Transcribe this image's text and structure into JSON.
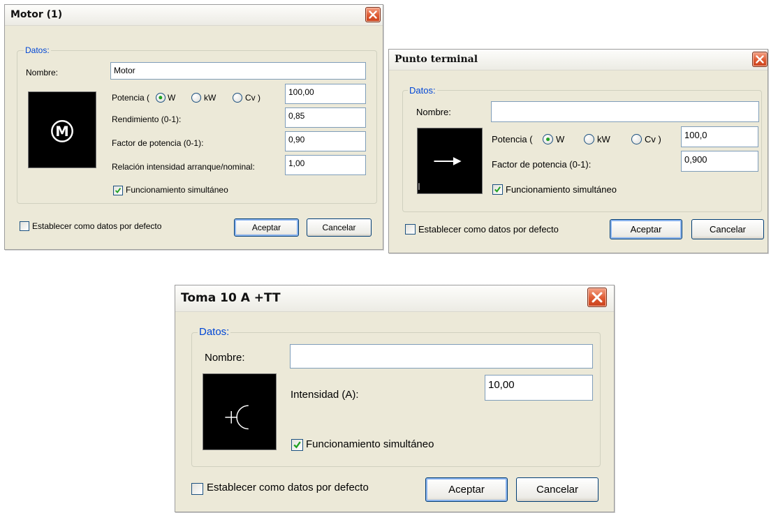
{
  "motor_dialog": {
    "title": "Motor (1)",
    "group_label": "Datos:",
    "name_label": "Nombre:",
    "name_value": "Motor",
    "icon_letter": "M",
    "power_label_prefix": "Potencia (",
    "power_units": [
      "W",
      "kW",
      "Cv )"
    ],
    "power_selected": "W",
    "power_value": "100,00",
    "efficiency_label": "Rendimiento (0-1):",
    "efficiency_value": "0,85",
    "power_factor_label": "Factor de potencia (0-1):",
    "power_factor_value": "0,90",
    "start_ratio_label": "Relación intensidad arranque/nominal:",
    "start_ratio_value": "1,00",
    "simultaneous_label": "Funcionamiento simultáneo",
    "simultaneous_checked": true,
    "default_label": "Establecer como datos por defecto",
    "default_checked": false,
    "accept_label": "Aceptar",
    "cancel_label": "Cancelar"
  },
  "terminal_dialog": {
    "title": "Punto terminal",
    "group_label": "Datos:",
    "name_label": "Nombre:",
    "name_value": "",
    "power_label_prefix": "Potencia (",
    "power_units": [
      "W",
      "kW",
      "Cv )"
    ],
    "power_selected": "W",
    "power_value": "100,0",
    "power_factor_label": "Factor de potencia (0-1):",
    "power_factor_value": "0,900",
    "simultaneous_label": "Funcionamiento simultáneo",
    "simultaneous_checked": true,
    "default_label": "Establecer como datos por defecto",
    "default_checked": false,
    "accept_label": "Aceptar",
    "cancel_label": "Cancelar"
  },
  "toma_dialog": {
    "title": "Toma 10 A +TT",
    "group_label": "Datos:",
    "name_label": "Nombre:",
    "name_value": "",
    "current_label": "Intensidad (A):",
    "current_value": "10,00",
    "simultaneous_label": "Funcionamiento simultáneo",
    "simultaneous_checked": true,
    "default_label": "Establecer como datos por defecto",
    "default_checked": false,
    "accept_label": "Aceptar",
    "cancel_label": "Cancelar"
  },
  "colors": {
    "dialog_bg": "#ece9d8",
    "group_label": "#0046d5",
    "close_button": "#de5a32",
    "check_mark": "#21a121"
  }
}
